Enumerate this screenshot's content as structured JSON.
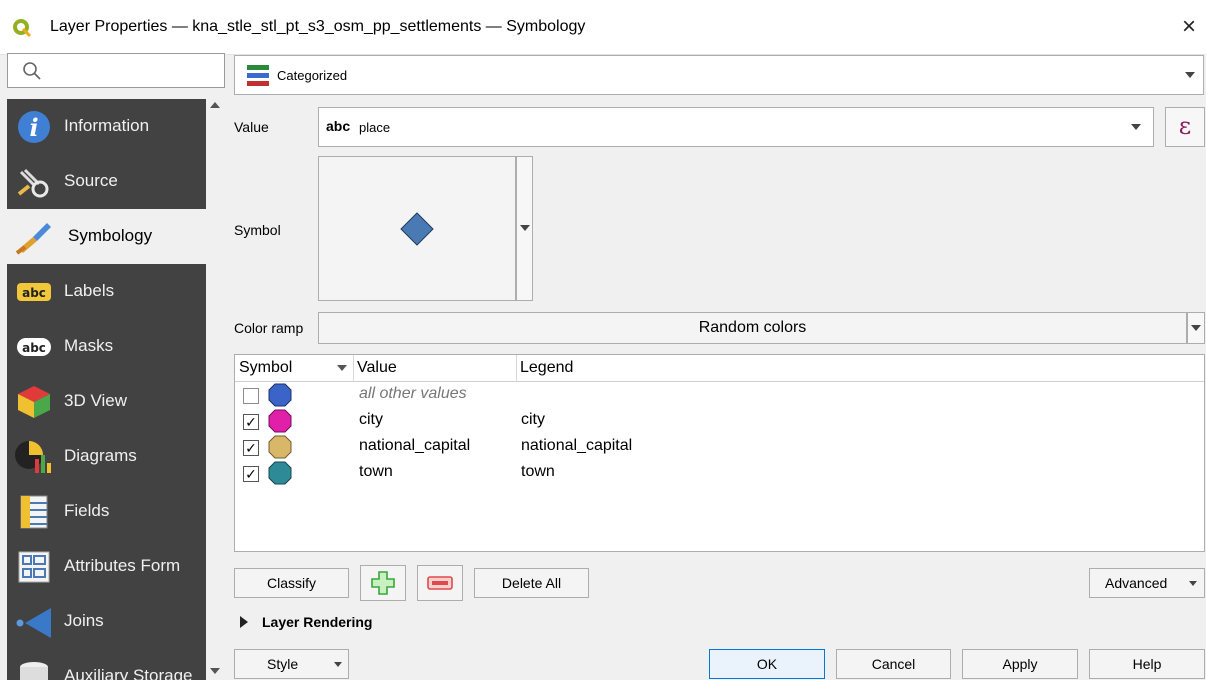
{
  "window": {
    "title": "Layer Properties — kna_stle_stl_pt_s3_osm_pp_settlements — Symbology",
    "close_glyph": "×"
  },
  "search": {
    "placeholder": "",
    "value": ""
  },
  "sidebar": {
    "items": [
      {
        "label": "Information",
        "icon": "information-icon",
        "active": false
      },
      {
        "label": "Source",
        "icon": "source-icon",
        "active": false
      },
      {
        "label": "Symbology",
        "icon": "symbology-paintbrush-icon",
        "active": true
      },
      {
        "label": "Labels",
        "icon": "labels-abc-icon",
        "active": false
      },
      {
        "label": "Masks",
        "icon": "masks-abc-icon",
        "active": false
      },
      {
        "label": "3D View",
        "icon": "3d-cube-icon",
        "active": false
      },
      {
        "label": "Diagrams",
        "icon": "diagrams-icon",
        "active": false
      },
      {
        "label": "Fields",
        "icon": "fields-icon",
        "active": false
      },
      {
        "label": "Attributes Form",
        "icon": "attributes-form-icon",
        "active": false
      },
      {
        "label": "Joins",
        "icon": "joins-icon",
        "active": false
      },
      {
        "label": "Auxiliary Storage",
        "icon": "auxiliary-storage-icon",
        "active": false
      }
    ]
  },
  "renderer": {
    "selected": "Categorized",
    "icon": "categorized-renderer-icon"
  },
  "value_field": {
    "label": "Value",
    "type_badge": "abc",
    "value": "place",
    "expression_glyph": "ε"
  },
  "symbol": {
    "label": "Symbol",
    "shape": "diamond",
    "color": "#4a7ab3"
  },
  "color_ramp": {
    "label": "Color ramp",
    "value": "Random colors"
  },
  "table": {
    "headers": [
      "Symbol",
      "Value",
      "Legend"
    ],
    "rows": [
      {
        "checked": false,
        "color": "#3a64c8",
        "value": "all other values",
        "legend": "",
        "italic": true
      },
      {
        "checked": true,
        "color": "#e020a8",
        "value": "city",
        "legend": "city",
        "italic": false
      },
      {
        "checked": true,
        "color": "#d8b868",
        "value": "national_capital",
        "legend": "national_capital",
        "italic": false
      },
      {
        "checked": true,
        "color": "#2e8a96",
        "value": "town",
        "legend": "town",
        "italic": false
      }
    ]
  },
  "buttons": {
    "classify": "Classify",
    "delete_all": "Delete All",
    "advanced": "Advanced",
    "style": "Style",
    "ok": "OK",
    "cancel": "Cancel",
    "apply": "Apply",
    "help": "Help"
  },
  "layer_rendering": {
    "label": "Layer Rendering"
  },
  "colors": {
    "sidebar_bg": "#424242",
    "accent": "#0078d7",
    "add_green": "#3aa63a",
    "remove_red": "#e04a4a"
  }
}
